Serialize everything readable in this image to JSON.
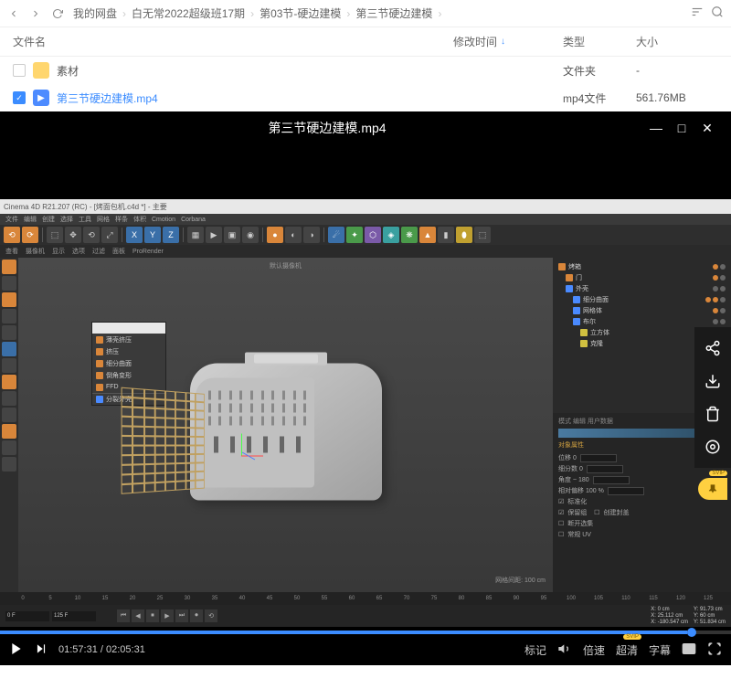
{
  "nav": {
    "breadcrumb": [
      "我的网盘",
      "白无常2022超级班17期",
      "第03节-硬边建模",
      "第三节硬边建模"
    ]
  },
  "columns": {
    "name": "文件名",
    "time": "修改时间",
    "type": "类型",
    "size": "大小"
  },
  "files": [
    {
      "name": "素材",
      "type": "文件夹",
      "size": "-",
      "kind": "folder",
      "checked": false
    },
    {
      "name": "第三节硬边建模.mp4",
      "type": "mp4文件",
      "size": "561.76MB",
      "kind": "video",
      "checked": true
    }
  ],
  "player": {
    "title": "第三节硬边建模.mp4"
  },
  "c4d": {
    "title": "Cinema 4D R21.207 (RC) - [烤面包机.c4d *] - 主要",
    "menus": [
      "文件",
      "编辑",
      "创建",
      "选择",
      "工具",
      "网格",
      "样条",
      "体积",
      "Cmotion",
      "Corbana"
    ],
    "toolbar2": [
      "查看",
      "摄像机",
      "显示",
      "选项",
      "过滤",
      "面板",
      "ProRender"
    ],
    "viewport_label": "默认摄像机",
    "context": [
      "薄壳挤压",
      "挤压",
      "细分曲面",
      "倒角变形",
      "FFD",
      "分裂外壳"
    ],
    "tree": [
      "烤箱",
      "门",
      "外壳",
      "细分曲面",
      "网格体",
      "布尔",
      "立方体",
      "克隆"
    ],
    "attr_header": "模式 编辑 用户数据",
    "attr": [
      "对象属性",
      "位移 0",
      "细分数 0",
      "角度 ~ 180",
      "相对偏移 100 %",
      "标准化",
      "保留组",
      "创建封盖",
      "断开选集",
      "常规 UV"
    ],
    "timeline_ticks": [
      "0",
      "5",
      "10",
      "15",
      "20",
      "25",
      "30",
      "35",
      "40",
      "45",
      "50",
      "55",
      "60",
      "65",
      "70",
      "75",
      "80",
      "85",
      "90",
      "95",
      "100",
      "105",
      "110",
      "115",
      "120",
      "125"
    ],
    "coords": [
      "X: 0 cm",
      "Y: 91.73 cm",
      "X: 25.112 cm",
      "Y: 60 cm",
      "X: -180.547 cm",
      "Y: 51.834 cm"
    ],
    "scale_label": "网格间距: 100 cm"
  },
  "controls": {
    "current": "01:57:31",
    "total": "02:05:31",
    "mark": "标记",
    "speed": "倍速",
    "quality": "超清",
    "subtitle": "字幕",
    "svip": "SVIP"
  }
}
